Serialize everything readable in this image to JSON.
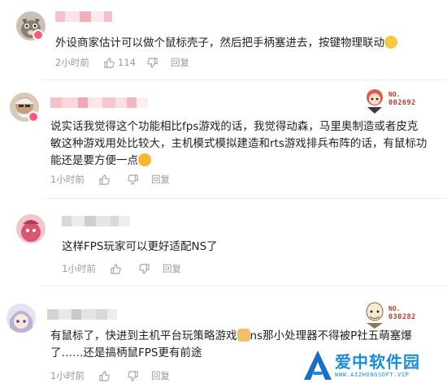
{
  "comments": [
    {
      "text_lines": [
        "外设商家估计可以做个鼠标壳子，然后把手柄塞进去，按键物理联动"
      ],
      "time": "2小时前",
      "likes": "114",
      "reply_label": "回复",
      "avatar_icon": "avatar-cat-icon",
      "emoji_icon": "pondering-face-icon"
    },
    {
      "text_lines": [
        "说实话我觉得这个功能相比fps游戏的话，我觉得动森，马里奥制造或者皮克",
        "敏这种游戏用处比较大，主机模式模拟建造和rts游戏排兵布阵的话，有鼠标功",
        "能还是要方便一点"
      ],
      "time": "1小时前",
      "likes": "",
      "reply_label": "回复",
      "avatar_icon": "avatar-grandpa-icon",
      "emoji_icon": "surprised-face-icon",
      "badge": {
        "prefix": "NO.",
        "number": "002692"
      }
    },
    {
      "text_lines": [
        "这样FPS玩家可以更好适配NS了"
      ],
      "time": "1小时前",
      "likes": "",
      "reply_label": "回复",
      "avatar_icon": "avatar-pink-icon"
    },
    {
      "text_lines": [
        "有鼠标了，快进到主机平台玩策略游戏",
        "ns那小处理器不得被P社五萌塞爆",
        "了……还是搞柄鼠FPS更有前途"
      ],
      "time": "1小时前",
      "likes": "",
      "reply_label": "回复",
      "avatar_icon": "avatar-anime-girl-icon",
      "emoji_icon": "cat-face-icon",
      "badge": {
        "prefix": "NO.",
        "number": "030282"
      }
    }
  ],
  "watermark": {
    "title": "爱中软件园",
    "subtitle": "WWW.AIZHONGSOFT.VIP",
    "icon": "a-logo-icon"
  },
  "colors": {
    "meta_text": "#9a9a9a",
    "body_text": "#222222",
    "badge_red": "#c0392b",
    "watermark_blue": "#1a8cdc"
  }
}
